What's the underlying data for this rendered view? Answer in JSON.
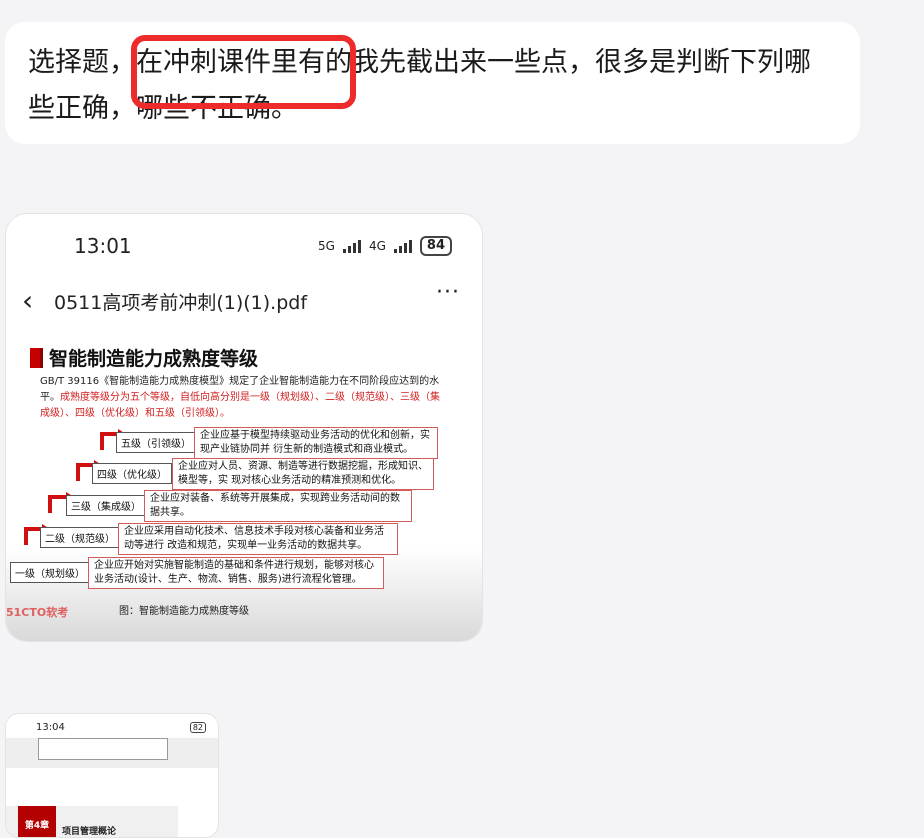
{
  "message": {
    "line1": "选择题，在冲刺课件里有的我先截出来一些点，很多是判断下列哪",
    "line2": "些正确，哪些不正确。"
  },
  "screenshot1": {
    "time": "13:01",
    "net1": "5G",
    "net2": "4G",
    "battery": "84",
    "back_icon": "chevron-left-icon",
    "file_title": "0511高项考前冲刺(1)(1).pdf",
    "more_label": "···",
    "page": {
      "title": "智能制造能力成熟度等级",
      "intro_black": "GB/T 39116《智能制造能力成熟度模型》规定了企业智能制造能力在不同阶段应达到的水平。",
      "intro_red": "成熟度等级分为五个等级，自低向高分别是一级（规划级）、二级（规范级）、三级（集 成级）、四级（优化级）和五级（引领级）。",
      "levels": [
        {
          "name": "五级（引领级）",
          "desc": "企业应基于模型持续驱动业务活动的优化和创新，实现产业链协同并 衍生新的制造模式和商业模式。"
        },
        {
          "name": "四级（优化级）",
          "desc": "企业应对人员、资源、制造等进行数据挖掘，形成知识、模型等，实 现对核心业务活动的精准预测和优化。"
        },
        {
          "name": "三级（集成级）",
          "desc": "企业应对装备、系统等开展集成，实现跨业务活动间的数据共享。"
        },
        {
          "name": "二级（规范级）",
          "desc": "企业应采用自动化技术、信息技术手段对核心装备和业务活动等进行 改造和规范，实现单一业务活动的数据共享。"
        },
        {
          "name": "一级（规划级）",
          "desc": "企业应开始对实施智能制造的基础和条件进行规划，能够对核心业务活动(设计、生产、物流、销售、服务)进行流程化管理。"
        }
      ],
      "caption": "图：智能制造能力成熟度等级",
      "watermark": "51CTO软考"
    }
  },
  "screenshot2": {
    "time": "13:04",
    "battery": "82",
    "chapter_label": "第4章",
    "chapter_title": "项目管理概论"
  }
}
